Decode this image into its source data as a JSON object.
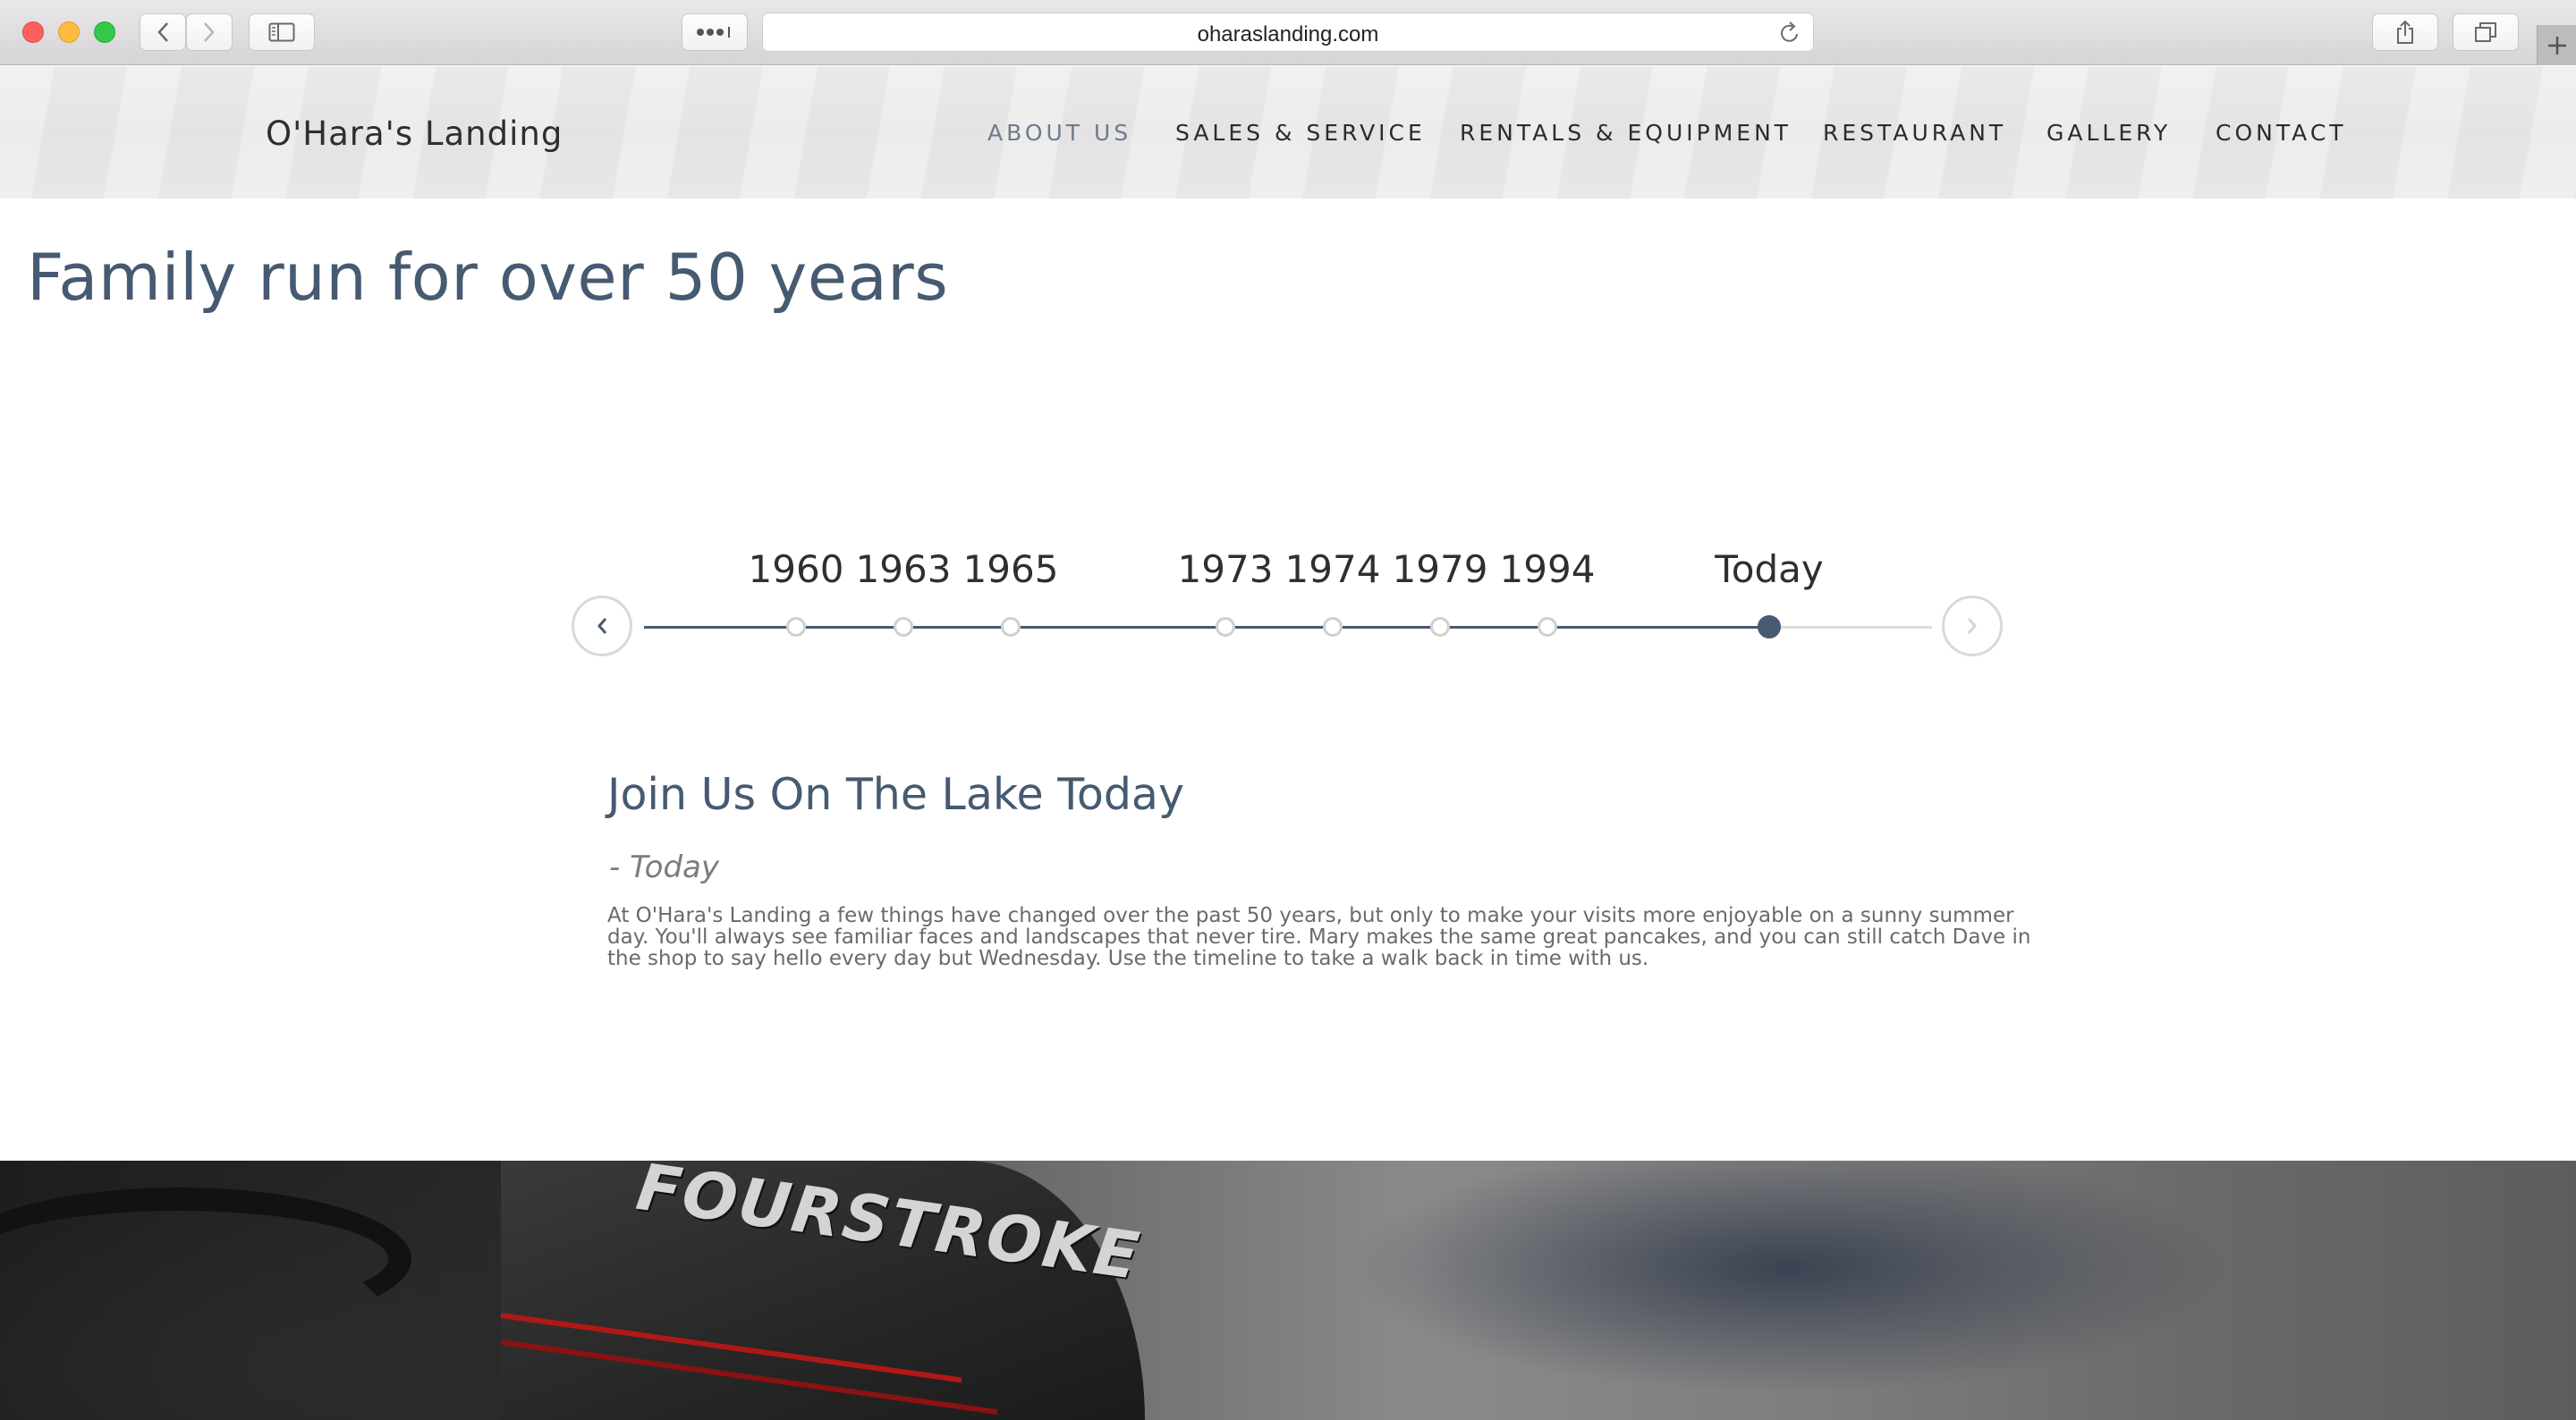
{
  "browser": {
    "url": "oharaslanding.com"
  },
  "site": {
    "brand": "O'Hara's Landing",
    "nav": [
      {
        "label": "ABOUT US",
        "active": true
      },
      {
        "label": "SALES & SERVICE",
        "active": false
      },
      {
        "label": "RENTALS & EQUIPMENT",
        "active": false
      },
      {
        "label": "RESTAURANT",
        "active": false
      },
      {
        "label": "GALLERY",
        "active": false
      },
      {
        "label": "CONTACT",
        "active": false
      }
    ]
  },
  "main": {
    "title": "Family run for over 50 years",
    "timeline": {
      "years": [
        "1960",
        "1963",
        "1965",
        "1973",
        "1974",
        "1979",
        "1994",
        "Today"
      ],
      "selected": "Today"
    },
    "event": {
      "title": "Join Us On The Lake Today",
      "date": "- Today",
      "body": "At O'Hara's Landing a few things have changed over the past 50 years, but only to make your visits more enjoyable on a sunny summer day. You'll always see familiar faces and landscapes that never tire. Mary makes the same great pancakes, and you can still catch Dave in the shop to say hello every day but Wednesday. Use the timeline to take a walk back in time with us."
    },
    "photo_text": "FOURSTROKE"
  },
  "colors": {
    "accent": "#465a71",
    "nav_active": "#6d7b8e",
    "timeline_inactive": "#dedede"
  }
}
